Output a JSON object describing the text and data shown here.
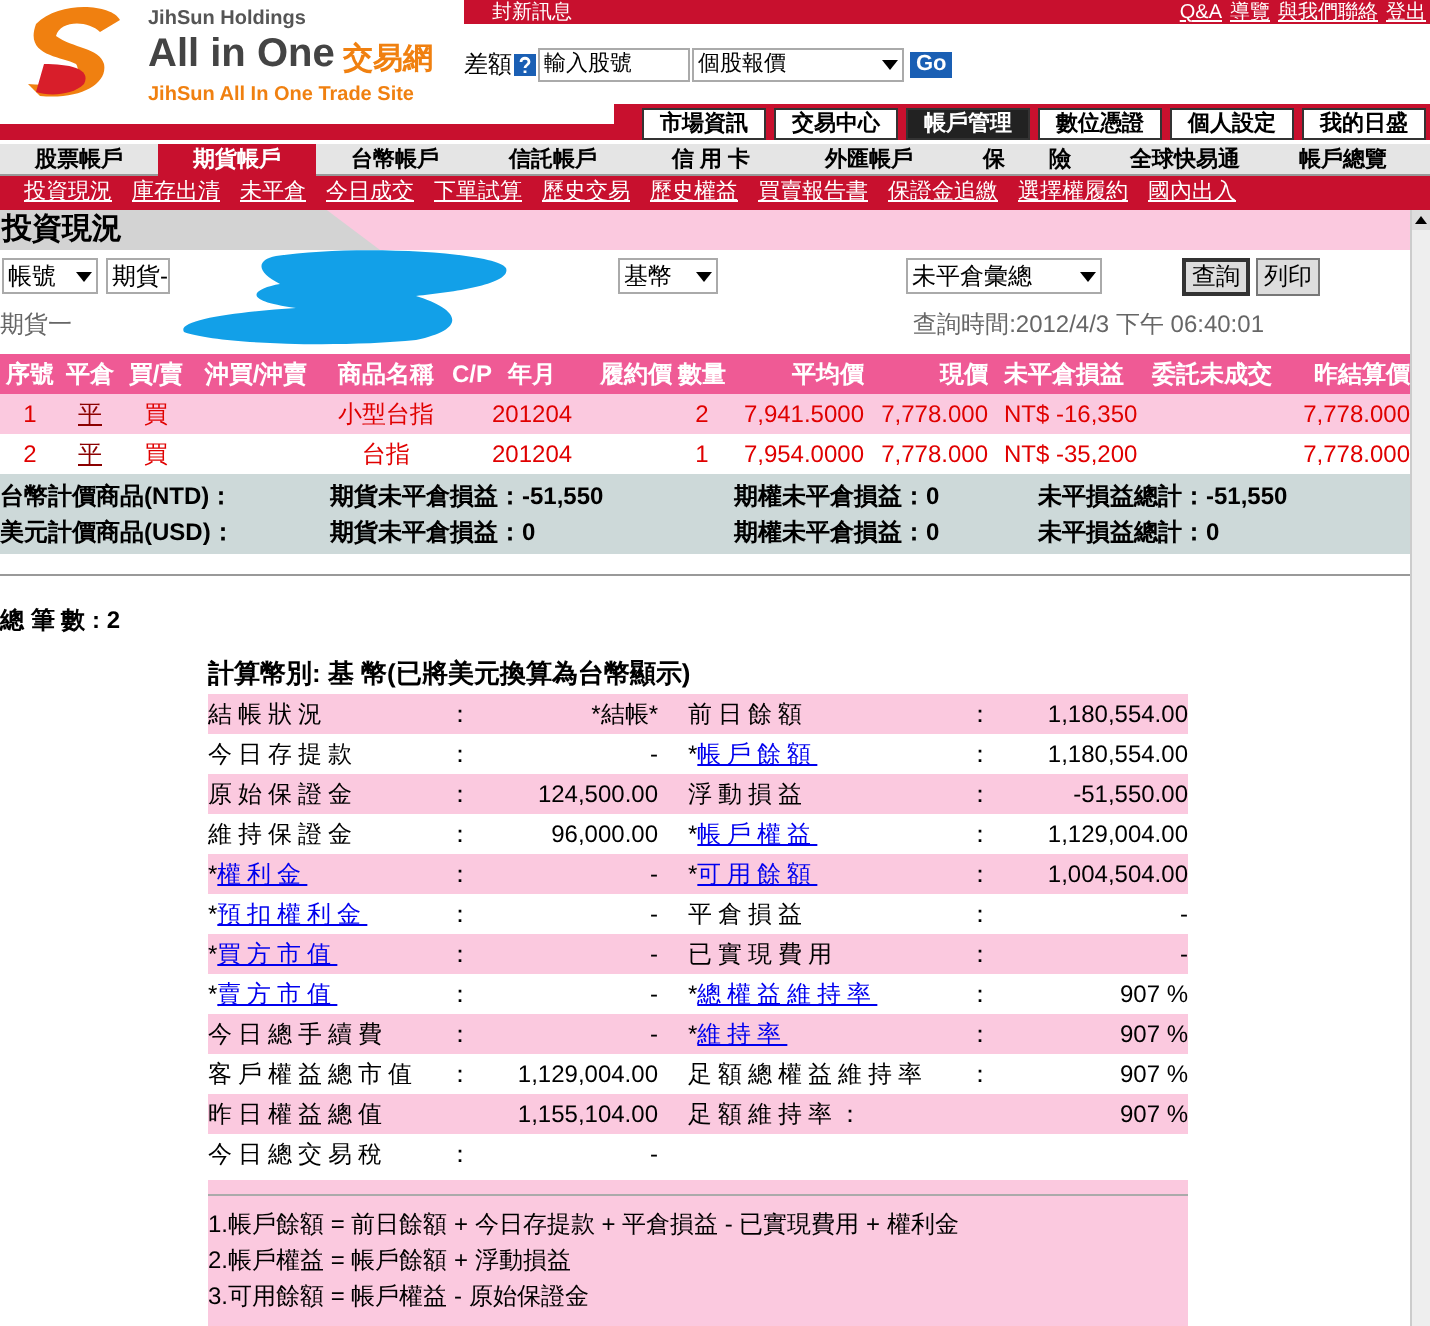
{
  "header": {
    "holdings": "JihSun Holdings",
    "brand": "All in One",
    "brand_cn": "交易網",
    "subtitle": "JihSun All In One Trade Site",
    "notice": "封新訊息",
    "top_links": [
      "Q&A",
      "導覽",
      "與我們聯絡",
      "登出"
    ],
    "search": {
      "label": "差額",
      "placeholder": "輸入股號",
      "select": "個股報價",
      "go": "Go"
    }
  },
  "main_tabs": [
    {
      "label": "市場資訊",
      "selected": false
    },
    {
      "label": "交易中心",
      "selected": false
    },
    {
      "label": "帳戶管理",
      "selected": true
    },
    {
      "label": "數位憑證",
      "selected": false
    },
    {
      "label": "個人設定",
      "selected": false
    },
    {
      "label": "我的日盛",
      "selected": false
    }
  ],
  "account_tabs": [
    {
      "label": "股票帳戶",
      "selected": false
    },
    {
      "label": "期貨帳戶",
      "selected": true
    },
    {
      "label": "台幣帳戶",
      "selected": false
    },
    {
      "label": "信託帳戶",
      "selected": false
    },
    {
      "label": "信 用 卡",
      "selected": false
    },
    {
      "label": "外匯帳戶",
      "selected": false
    },
    {
      "label": "保　　險",
      "selected": false
    },
    {
      "label": "全球快易通",
      "selected": false
    },
    {
      "label": "帳戶總覽",
      "selected": false
    }
  ],
  "sub_links": [
    "投資現況",
    "庫存出清",
    "未平倉",
    "今日成交",
    "下單試算",
    "歷史交易",
    "歷史權益",
    "買賣報告書",
    "保證金追繳",
    "選擇權履約",
    "國內出入"
  ],
  "page_title": "投資現況",
  "filters": {
    "account": "帳號",
    "account_value": "期貨-",
    "currency": "基幣",
    "view": "未平倉彙總",
    "buttons": [
      "查詢",
      "列印"
    ]
  },
  "account_label": "期貨一",
  "query_time": "查詢時間:2012/4/3 下午 06:40:01",
  "table": {
    "columns": [
      "序號",
      "平倉",
      "買/賣",
      "沖買/沖賣",
      "商品名稱",
      "C/P",
      "年月",
      "履約價",
      "數量",
      "平均價",
      "現價",
      "未平倉損益",
      "委託未成交",
      "昨結算價"
    ],
    "rows": [
      {
        "cells": [
          "1",
          "平",
          "買",
          "",
          "小型台指",
          "",
          "201204",
          "",
          "2",
          "7,941.5000",
          "7,778.000",
          "NT$ -16,350",
          "",
          "7,778.000"
        ]
      },
      {
        "cells": [
          "2",
          "平",
          "買",
          "",
          "台指",
          "",
          "201204",
          "",
          "1",
          "7,954.0000",
          "7,778.000",
          "NT$ -35,200",
          "",
          "7,778.000"
        ]
      }
    ]
  },
  "summary": [
    [
      "台幣計價商品(NTD)：",
      "期貨未平倉損益：-51,550",
      "期權未平倉損益：0",
      "未平損益總計：-51,550"
    ],
    [
      "美元計價商品(USD)：",
      "期貨未平倉損益：0",
      "期權未平倉損益：0",
      "未平損益總計：0"
    ]
  ],
  "total": "總 筆 數 : 2",
  "detail": {
    "title": "計算幣別: 基 幣(已將美元換算為台幣顯示)",
    "rows": [
      [
        {
          "label": "結帳狀況",
          "sep": "：",
          "value": "*結帳*"
        },
        {
          "label": "前日餘額",
          "sep": "：",
          "value": "1,180,554.00"
        }
      ],
      [
        {
          "label": "今日存提款",
          "sep": "：",
          "value": "-"
        },
        {
          "prefix": "*",
          "label": "帳戶餘額",
          "link": true,
          "sep": "：",
          "value": "1,180,554.00"
        }
      ],
      [
        {
          "label": "原始保證金",
          "sep": "：",
          "value": "124,500.00"
        },
        {
          "label": "浮動損益",
          "sep": "：",
          "value": "-51,550.00"
        }
      ],
      [
        {
          "label": "維持保證金",
          "sep": "：",
          "value": "96,000.00"
        },
        {
          "prefix": "*",
          "label": "帳戶權益",
          "link": true,
          "sep": "：",
          "value": "1,129,004.00"
        }
      ],
      [
        {
          "prefix": "*",
          "label": "權利金",
          "link": true,
          "sep": "：",
          "value": "-"
        },
        {
          "prefix": "*",
          "label": "可用餘額",
          "link": true,
          "sep": "：",
          "value": "1,004,504.00"
        }
      ],
      [
        {
          "prefix": "*",
          "label": "預扣權利金",
          "link": true,
          "sep": "：",
          "value": "-"
        },
        {
          "label": "平倉損益",
          "sep": "：",
          "value": "-"
        }
      ],
      [
        {
          "prefix": "*",
          "label": "買方市值",
          "link": true,
          "sep": "：",
          "value": "-"
        },
        {
          "label": "已實現費用",
          "sep": "：",
          "value": "-"
        }
      ],
      [
        {
          "prefix": "*",
          "label": "賣方市值",
          "link": true,
          "sep": "：",
          "value": "-"
        },
        {
          "prefix": "*",
          "label": "總權益維持率",
          "link": true,
          "sep": "：",
          "value": "907 %"
        }
      ],
      [
        {
          "label": "今日總手續費",
          "sep": "：",
          "value": "-"
        },
        {
          "prefix": "*",
          "label": "維持率",
          "link": true,
          "sep": "：",
          "value": "907 %"
        }
      ],
      [
        {
          "label": "客戶權益總市值",
          "sep": "：",
          "value": "1,129,004.00"
        },
        {
          "label": "足額總權益維持率",
          "sep": "：",
          "value": "907 %"
        }
      ],
      [
        {
          "label": "昨日權益總值",
          "value": "1,155,104.00"
        },
        {
          "label": "足額維持率：",
          "value": "907 %"
        }
      ],
      [
        {
          "label": "今日總交易稅",
          "sep": "：",
          "value": "-"
        }
      ]
    ]
  },
  "notes": [
    "1.帳戶餘額 = 前日餘額 + 今日存提款 + 平倉損益 - 已實現費用 + 權利金",
    "2.帳戶權益 = 帳戶餘額 + 浮動損益",
    "3.可用餘額 = 帳戶權益 - 原始保證金"
  ]
}
